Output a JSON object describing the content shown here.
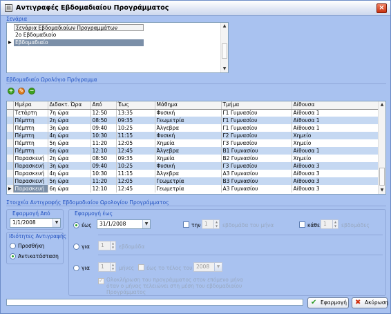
{
  "window": {
    "title": "Αντιγραφές Εβδομαδιαίου Προγράμματος",
    "close_label": "×"
  },
  "scenario": {
    "section_label": "Σενάρια",
    "header": "Σενάρια Εβδομαδιαίων Προγραμμάτων",
    "rows": [
      "2ο Εβδομαδιαίο",
      "Εβδομαδιαίο"
    ]
  },
  "weekly": {
    "section_label": "Εβδομαδιαίο Ωρολόγιο Πρόγραμμα",
    "columns": [
      "Ημέρα",
      "Διδακτ. Ώρα",
      "Από",
      "Έως",
      "Μάθημα",
      "Τμήμα",
      "Αίθουσα"
    ],
    "rows": [
      [
        "Τετάρτη",
        "7η ώρα",
        "12:50",
        "13:35",
        "Φυσική",
        "Γ1 Γυμνασίου",
        "Αίθουσα 1"
      ],
      [
        "Πέμπτη",
        "2η ώρα",
        "08:50",
        "09:35",
        "Γεωμετρία",
        "Γ1 Γυμνασίου",
        "Αίθουσα 1"
      ],
      [
        "Πέμπτη",
        "3η ώρα",
        "09:40",
        "10:25",
        "Άλγεβρα",
        "Γ1 Γυμνασίου",
        "Αίθουσα 1"
      ],
      [
        "Πέμπτη",
        "4η ώρα",
        "10:30",
        "11:15",
        "Φυσική",
        "Γ2 Γυμνασίου",
        "Χημείο"
      ],
      [
        "Πέμπτη",
        "5η ώρα",
        "11:20",
        "12:05",
        "Χημεία",
        "Γ3 Γυμνασίου",
        "Χημείο"
      ],
      [
        "Πέμπτη",
        "6η ώρα",
        "12:10",
        "12:45",
        "Άλγεβρα",
        "B1 Γυμνασίου",
        "Αίθουσα 1"
      ],
      [
        "Παρασκευή",
        "2η ώρα",
        "08:50",
        "09:35",
        "Χημεία",
        "B2 Γυμνασίου",
        "Χημείο"
      ],
      [
        "Παρασκευή",
        "3η ώρα",
        "09:40",
        "10:25",
        "Φυσική",
        "Γ3 Γυμνασίου",
        "Αίθουσα 3"
      ],
      [
        "Παρασκευή",
        "4η ώρα",
        "10:30",
        "11:15",
        "Άλγεβρα",
        "Α3 Γυμνασίου",
        "Αίθουσα 3"
      ],
      [
        "Παρασκευή",
        "5η ώρα",
        "11:20",
        "12:05",
        "Γεωμετρία",
        "B3 Γυμνασίου",
        "Αίθουσα 3"
      ],
      [
        "Παρασκευή",
        "6η ώρα",
        "12:10",
        "12:45",
        "Γεωμετρία",
        "Α3 Γυμνασίου",
        "Αίθουσα 3"
      ]
    ]
  },
  "copy": {
    "section_label": "Στοιχεία Αντιγραφής Εβδομαδιαίου Ωρολογίου Προγράμματος",
    "from_label": "Εφαρμογή Από",
    "from_date": "1/1/2008",
    "props_label": "Ιδιότητες Αντιγραφής",
    "add_label": "Προσθήκη",
    "replace_label": "Αντικατάσταση",
    "to_label": "Εφαρμογή έως",
    "until_label": "έως",
    "until_date": "31/1/2008",
    "the_label": "την",
    "the_value": "1",
    "week_of_month": "εβδομάδα του μήνα",
    "every_label": "κάθε",
    "every_value": "1",
    "weeks_label": "εβδομάδες",
    "for_label1": "για",
    "for_value1": "1",
    "week_label": "εβδομάδα",
    "for_label2": "για",
    "for_value2": "1",
    "months_label": "μήνες",
    "year_end_label": "έως το τέλος του",
    "year_value": "2008",
    "note": "Ολοκλήρωση του προγράμματος στον επόμενο μήνα όταν ο μήνας τελειώνει στη μέση του εβδομαδιαίου Προγράμματος"
  },
  "buttons": {
    "apply": "Εφαρμογή",
    "cancel": "Ακύρωση"
  }
}
